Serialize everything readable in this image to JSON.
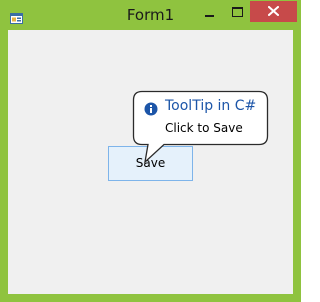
{
  "window": {
    "title": "Form1",
    "title_bar_color": "#8fc33f",
    "app_icon": "form-icon",
    "controls": {
      "minimize_icon": "minimize-icon",
      "maximize_icon": "maximize-icon",
      "close_icon": "close-icon",
      "close_color": "#c74a4a"
    }
  },
  "form": {
    "background": "#f0f0f0",
    "save_button": {
      "label": "Save"
    }
  },
  "tooltip": {
    "icon": "info-icon",
    "title": "ToolTip in C#",
    "text": "Click to Save",
    "title_color": "#1c55a8"
  }
}
